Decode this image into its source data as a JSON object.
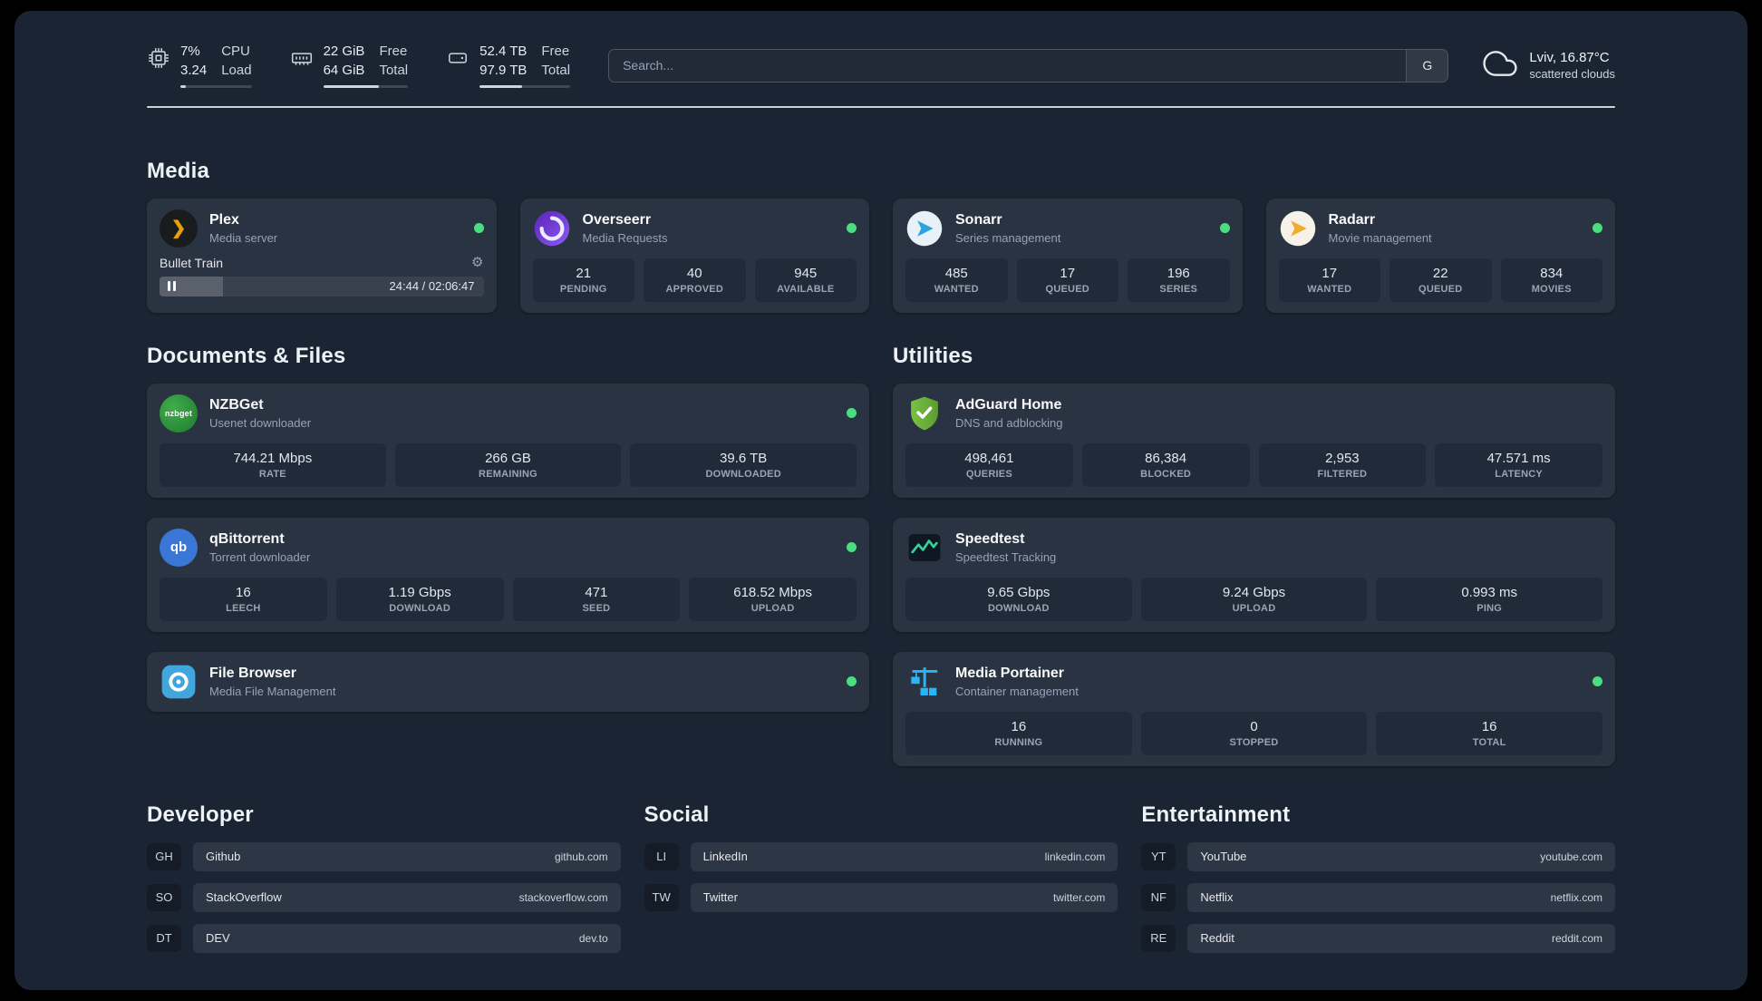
{
  "topbar": {
    "cpu": {
      "value_top": "7%",
      "value_bottom": "3.24",
      "label_top": "CPU",
      "label_bottom": "Load",
      "progress": 7
    },
    "memory": {
      "value_top": "22 GiB",
      "value_bottom": "64 GiB",
      "label_top": "Free",
      "label_bottom": "Total",
      "progress": 66
    },
    "disk": {
      "value_top": "52.4 TB",
      "value_bottom": "97.9 TB",
      "label_top": "Free",
      "label_bottom": "Total",
      "progress": 47
    },
    "search": {
      "placeholder": "Search...",
      "provider_label": "G"
    },
    "weather": {
      "location": "Lviv, 16.87°C",
      "condition": "scattered clouds"
    }
  },
  "icons": {
    "gear": "⚙",
    "plex_chevron": "❯",
    "nzbget_label": "nzbget",
    "qbittorrent_label": "qb"
  },
  "sections": {
    "media": {
      "title": "Media",
      "plex": {
        "name": "Plex",
        "desc": "Media server",
        "now_playing": "Bullet Train",
        "time": "24:44 / 02:06:47",
        "progress": 19.5
      },
      "overseerr": {
        "name": "Overseerr",
        "desc": "Media Requests",
        "stats": [
          {
            "value": "21",
            "label": "PENDING"
          },
          {
            "value": "40",
            "label": "APPROVED"
          },
          {
            "value": "945",
            "label": "AVAILABLE"
          }
        ]
      },
      "sonarr": {
        "name": "Sonarr",
        "desc": "Series management",
        "stats": [
          {
            "value": "485",
            "label": "WANTED"
          },
          {
            "value": "17",
            "label": "QUEUED"
          },
          {
            "value": "196",
            "label": "SERIES"
          }
        ]
      },
      "radarr": {
        "name": "Radarr",
        "desc": "Movie management",
        "stats": [
          {
            "value": "17",
            "label": "WANTED"
          },
          {
            "value": "22",
            "label": "QUEUED"
          },
          {
            "value": "834",
            "label": "MOVIES"
          }
        ]
      }
    },
    "documents": {
      "title": "Documents & Files",
      "nzbget": {
        "name": "NZBGet",
        "desc": "Usenet downloader",
        "stats": [
          {
            "value": "744.21 Mbps",
            "label": "RATE"
          },
          {
            "value": "266 GB",
            "label": "REMAINING"
          },
          {
            "value": "39.6 TB",
            "label": "DOWNLOADED"
          }
        ]
      },
      "qbittorrent": {
        "name": "qBittorrent",
        "desc": "Torrent downloader",
        "stats": [
          {
            "value": "16",
            "label": "LEECH"
          },
          {
            "value": "1.19 Gbps",
            "label": "DOWNLOAD"
          },
          {
            "value": "471",
            "label": "SEED"
          },
          {
            "value": "618.52 Mbps",
            "label": "UPLOAD"
          }
        ]
      },
      "filebrowser": {
        "name": "File Browser",
        "desc": "Media File Management"
      }
    },
    "utilities": {
      "title": "Utilities",
      "adguard": {
        "name": "AdGuard Home",
        "desc": "DNS and adblocking",
        "stats": [
          {
            "value": "498,461",
            "label": "QUERIES"
          },
          {
            "value": "86,384",
            "label": "BLOCKED"
          },
          {
            "value": "2,953",
            "label": "FILTERED"
          },
          {
            "value": "47.571 ms",
            "label": "LATENCY"
          }
        ]
      },
      "speedtest": {
        "name": "Speedtest",
        "desc": "Speedtest Tracking",
        "stats": [
          {
            "value": "9.65 Gbps",
            "label": "DOWNLOAD"
          },
          {
            "value": "9.24 Gbps",
            "label": "UPLOAD"
          },
          {
            "value": "0.993 ms",
            "label": "PING"
          }
        ]
      },
      "portainer": {
        "name": "Media Portainer",
        "desc": "Container management",
        "stats": [
          {
            "value": "16",
            "label": "RUNNING"
          },
          {
            "value": "0",
            "label": "STOPPED"
          },
          {
            "value": "16",
            "label": "TOTAL"
          }
        ]
      }
    }
  },
  "bookmarks": {
    "developer": {
      "title": "Developer",
      "items": [
        {
          "abbr": "GH",
          "name": "Github",
          "url": "github.com"
        },
        {
          "abbr": "SO",
          "name": "StackOverflow",
          "url": "stackoverflow.com"
        },
        {
          "abbr": "DT",
          "name": "DEV",
          "url": "dev.to"
        }
      ]
    },
    "social": {
      "title": "Social",
      "items": [
        {
          "abbr": "LI",
          "name": "LinkedIn",
          "url": "linkedin.com"
        },
        {
          "abbr": "TW",
          "name": "Twitter",
          "url": "twitter.com"
        }
      ]
    },
    "entertainment": {
      "title": "Entertainment",
      "items": [
        {
          "abbr": "YT",
          "name": "YouTube",
          "url": "youtube.com"
        },
        {
          "abbr": "NF",
          "name": "Netflix",
          "url": "netflix.com"
        },
        {
          "abbr": "RE",
          "name": "Reddit",
          "url": "reddit.com"
        }
      ]
    }
  }
}
